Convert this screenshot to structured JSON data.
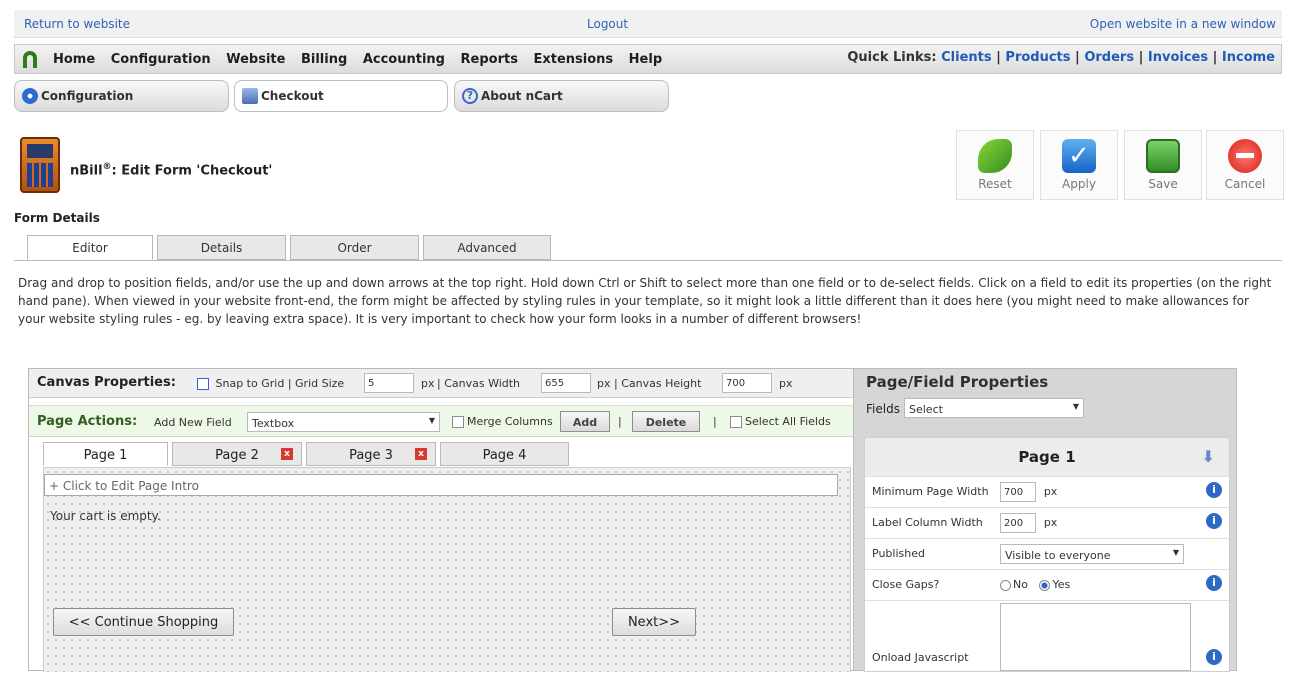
{
  "topbar": {
    "return_link": "Return to website",
    "logout_link": "Logout",
    "open_new_window": "Open website in a new window"
  },
  "menu": {
    "items": [
      "Home",
      "Configuration",
      "Website",
      "Billing",
      "Accounting",
      "Reports",
      "Extensions",
      "Help"
    ],
    "quick_links_label": "Quick Links:",
    "quick_links": [
      "Clients",
      "Products",
      "Orders",
      "Invoices",
      "Income"
    ]
  },
  "tabs": [
    {
      "label": "Configuration",
      "icon": "gear-icon"
    },
    {
      "label": "Checkout",
      "icon": "cart-icon"
    },
    {
      "label": "About nCart",
      "icon": "help-icon"
    }
  ],
  "header": {
    "brand": "nBill",
    "trademark": "®",
    "title_suffix": ": Edit Form 'Checkout'"
  },
  "toolbar": {
    "reset": "Reset",
    "apply": "Apply",
    "save": "Save",
    "cancel": "Cancel"
  },
  "form_details": {
    "heading": "Form Details",
    "tabs": [
      "Editor",
      "Details",
      "Order",
      "Advanced"
    ],
    "description": "Drag and drop to position fields, and/or use the up and down arrows at the top right. Hold down Ctrl or Shift to select more than one field or to de-select fields. Click on a field to edit its properties (on the right hand pane). When viewed in your website front-end, the form might be affected by styling rules in your template, so it might look a little different than it does here (you might need to make allowances for your website styling rules - eg. by leaving extra space). It is very important to check how your form looks in a number of different browsers!"
  },
  "canvas": {
    "props_label": "Canvas Properties:",
    "snap_to_grid": "Snap to Grid",
    "sep1": "|",
    "grid_size_label": "Grid Size",
    "grid_size_value": "5",
    "px": "px",
    "sep2": "| Canvas Width",
    "canvas_width_value": "655",
    "sep3": "| Canvas Height",
    "canvas_height_value": "700",
    "page_actions_label": "Page Actions:",
    "add_new_field_label": "Add New Field",
    "field_type": "Textbox",
    "merge_columns": "Merge Columns",
    "add_btn": "Add",
    "delete_btn": "Delete",
    "select_all_fields": "Select All Fields",
    "page_tabs": [
      "Page 1",
      "Page 2",
      "Page 3",
      "Page 4"
    ],
    "page_intro": "+ Click to Edit Page Intro",
    "cart_empty": "Your cart is empty.",
    "continue_shopping": "<< Continue Shopping",
    "next": "Next>>"
  },
  "props": {
    "title": "Page/Field Properties",
    "fields_label": "Fields",
    "fields_value": "Select",
    "page_title": "Page 1",
    "rows": [
      {
        "label": "Minimum Page Width",
        "value": "700",
        "unit": "px"
      },
      {
        "label": "Label Column Width",
        "value": "200",
        "unit": "px"
      },
      {
        "label": "Published",
        "value": "Visible to everyone"
      },
      {
        "label": "Close Gaps?",
        "no": "No",
        "yes": "Yes"
      },
      {
        "label": "Onload Javascript",
        "value": ""
      }
    ]
  }
}
